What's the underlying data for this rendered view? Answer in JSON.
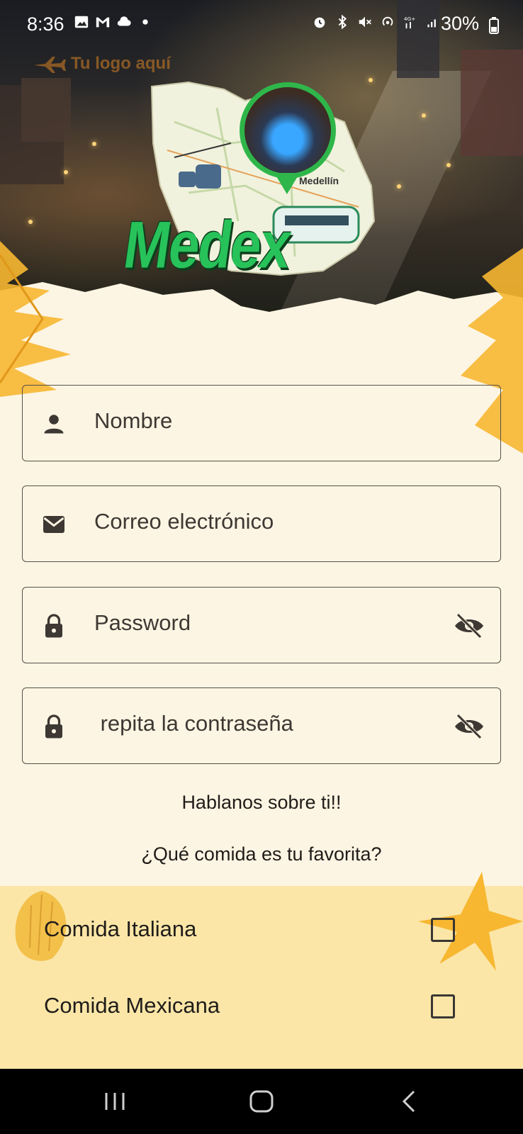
{
  "status_bar": {
    "time": "8:36",
    "battery": "30%",
    "network": "4G+"
  },
  "logo": {
    "placeholder_text": "Tu logo aquí",
    "brand": "Medex",
    "map_label": "Medellín"
  },
  "form": {
    "name_placeholder": "Nombre",
    "email_placeholder": "Correo electrónico",
    "password_placeholder": "Password",
    "repeat_password_placeholder": " repita la contraseña"
  },
  "about": {
    "heading": "Hablanos sobre ti!!",
    "question": "¿Qué comida es tu favorita?"
  },
  "food_options": [
    {
      "label": "Comida Italiana",
      "checked": false
    },
    {
      "label": "Comida Mexicana",
      "checked": false
    }
  ],
  "colors": {
    "background": "#fdf5e3",
    "brand_green": "#27c25a",
    "accent_yellow": "#f7b731",
    "text": "#1f1c19"
  }
}
